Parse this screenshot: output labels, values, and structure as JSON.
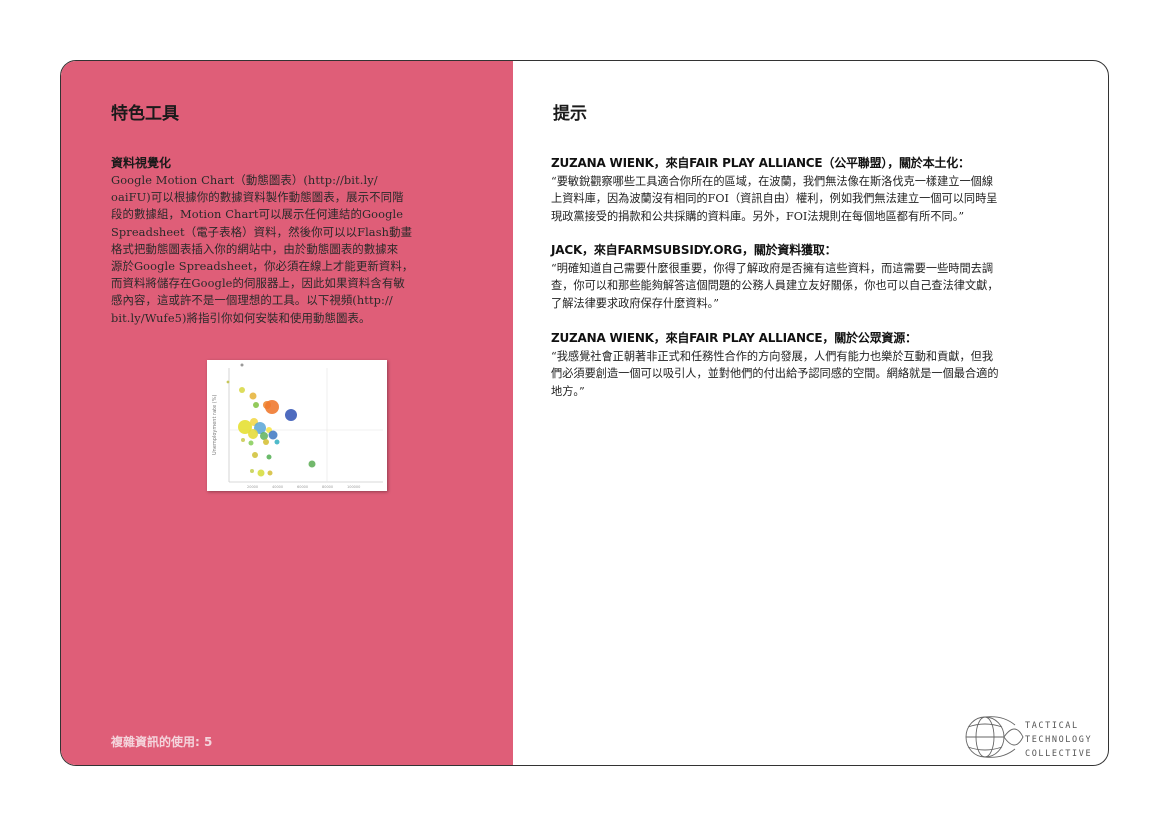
{
  "left_panel": {
    "title": "特色工具",
    "tool_heading": "資料視覺化",
    "tool_body": "Google Motion Chart（動態圖表）(http://bit.ly/\noaiFU)可以根據你的數據資料製作動態圖表，展示不同階\n段的數據組，Motion Chart可以展示任何連結的Google\nSpreadsheet（電子表格）資料，然後你可以以Flash動畫\n格式把動態圖表插入你的網站中，由於動態圖表的數據來\n源於Google Spreadsheet，你必須在線上才能更新資料，\n而資料將儲存在Google的伺服器上，因此如果資料含有敏\n感內容，這或許不是一個理想的工具。以下視頻(http://\nbit.ly/Wufe5)將指引你如何安裝和使用動態圖表。",
    "thumbnail_icon": "motion-chart-screenshot",
    "footer": "複雜資訊的使用: 5",
    "background_color": "#df5e78"
  },
  "right_panel": {
    "title": "提示",
    "tips": [
      {
        "heading": "ZUZANA WIENK，來自FAIR PLAY ALLIANCE（公平聯盟），關於本土化：",
        "body": "“要敏銳觀察哪些工具適合你所在的區域，在波蘭，我們無法像在斯洛伐克一樣建立一個線\n上資料庫，因為波蘭沒有相同的FOI（資訊自由）權利，例如我們無法建立一個可以同時呈\n現政黨接受的捐款和公共採購的資料庫。另外，FOI法規則在每個地區都有所不同。”"
      },
      {
        "heading": "JACK，來自FARMSUBSIDY.ORG，關於資料獲取：",
        "body": "“明確知道自己需要什麼很重要，你得了解政府是否擁有這些資料，而這需要一些時間去調\n查，你可以和那些能夠解答這個問題的公務人員建立友好關係，你也可以自己查法律文獻，\n了解法律要求政府保存什麼資料。”"
      },
      {
        "heading": "ZUZANA WIENK，來自FAIR PLAY ALLIANCE，關於公眾資源：",
        "body": "“我感覺社會正朝著非正式和任務性合作的方向發展，人們有能力也樂於互動和貢獻，但我\n們必須要創造一個可以吸引人，並對他們的付出給予認同感的空間。網絡就是一個最合適的\n地方。”"
      }
    ],
    "logo": {
      "icon": "tactical-tech-globe-logo",
      "line1": "TACTICAL",
      "line2": "TECHNOLOGY",
      "line3": "COLLECTIVE"
    }
  }
}
